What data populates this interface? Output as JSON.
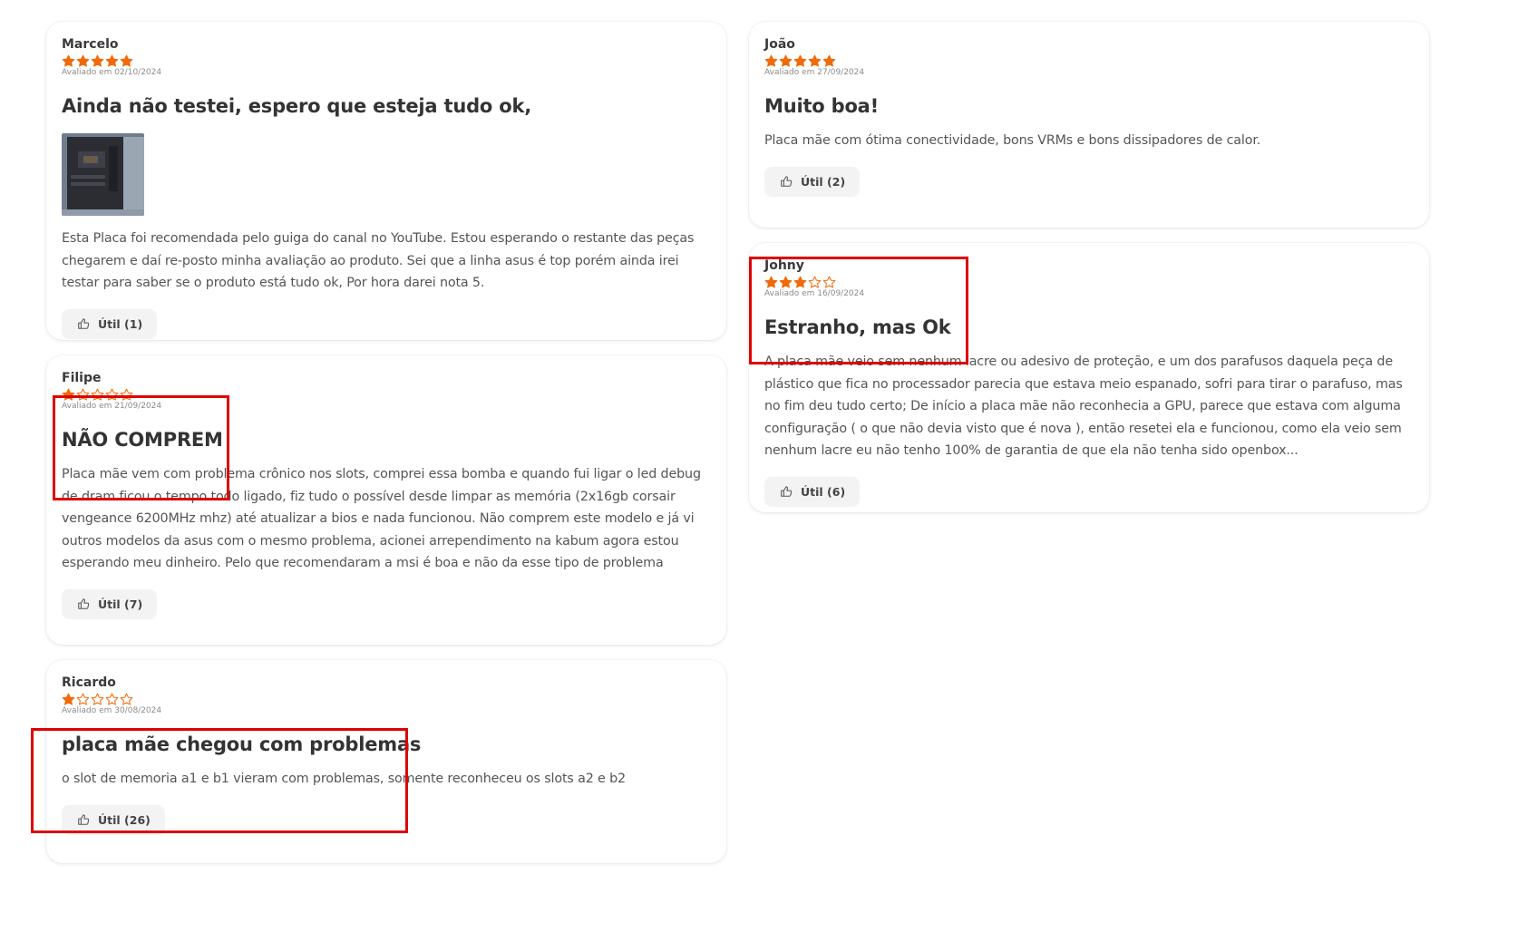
{
  "colors": {
    "star": "#f06a0b",
    "highlight": "#e00000"
  },
  "reviews_left": [
    {
      "author": "Marcelo",
      "rating": 5,
      "date": "Avaliado em 02/10/2024",
      "title": "Ainda não testei, espero que esteja tudo ok,",
      "has_image": true,
      "image_icon": "product-photo-thumbnail",
      "body": "Esta Placa foi recomendada pelo guiga do canal no YouTube. Estou esperando o restante das peças chegarem e daí re-posto minha avaliação ao produto. Sei que a linha asus é top porém ainda irei testar para saber se o produto está tudo ok, Por hora darei nota 5.",
      "helpful": "Útil (1)"
    },
    {
      "author": "Filipe",
      "rating": 1,
      "date": "Avaliado em 21/09/2024",
      "title": "NÃO COMPREM",
      "body": "Placa mãe vem com problema crônico nos slots, comprei essa bomba e quando fui ligar o led debug de dram ficou o tempo todo ligado, fiz tudo o possível desde limpar as memória (2x16gb corsair vengeance 6200MHz mhz) até atualizar a bios e nada funcionou. Não comprem este modelo e já vi outros modelos da asus com o mesmo problema, acionei arrependimento na kabum agora estou esperando meu dinheiro. Pelo que recomendaram a msi é boa e não da esse tipo de problema",
      "helpful": "Útil (7)"
    },
    {
      "author": "Ricardo",
      "rating": 1,
      "date": "Avaliado em 30/08/2024",
      "title": "placa mãe chegou com problemas",
      "body": "o slot de memoria a1 e b1 vieram com problemas, somente reconheceu os slots a2 e b2",
      "helpful": "Útil (26)"
    }
  ],
  "reviews_right": [
    {
      "author": "João",
      "rating": 5,
      "date": "Avaliado em 27/09/2024",
      "title": "Muito boa!",
      "body": "Placa mãe com ótima conectividade, bons VRMs e bons dissipadores de calor.",
      "helpful": "Útil (2)"
    },
    {
      "author": "Johny",
      "rating": 3,
      "date": "Avaliado em 16/09/2024",
      "title": "Estranho, mas Ok",
      "body": "A placa mãe veio sem nenhum lacre ou adesivo de proteção, e um dos parafusos daquela peça de plástico que fica no processador parecia que estava meio espanado, sofri para tirar o parafuso, mas no fim deu tudo certo; De início a placa mãe não reconhecia a GPU, parece que estava com alguma configuração ( o que não devia visto que é nova ), então resetei ela e funcionou, como ela veio sem nenhum lacre eu não tenho 100% de garantia de que ela não tenha sido openbox...",
      "helpful": "Útil (6)"
    }
  ]
}
